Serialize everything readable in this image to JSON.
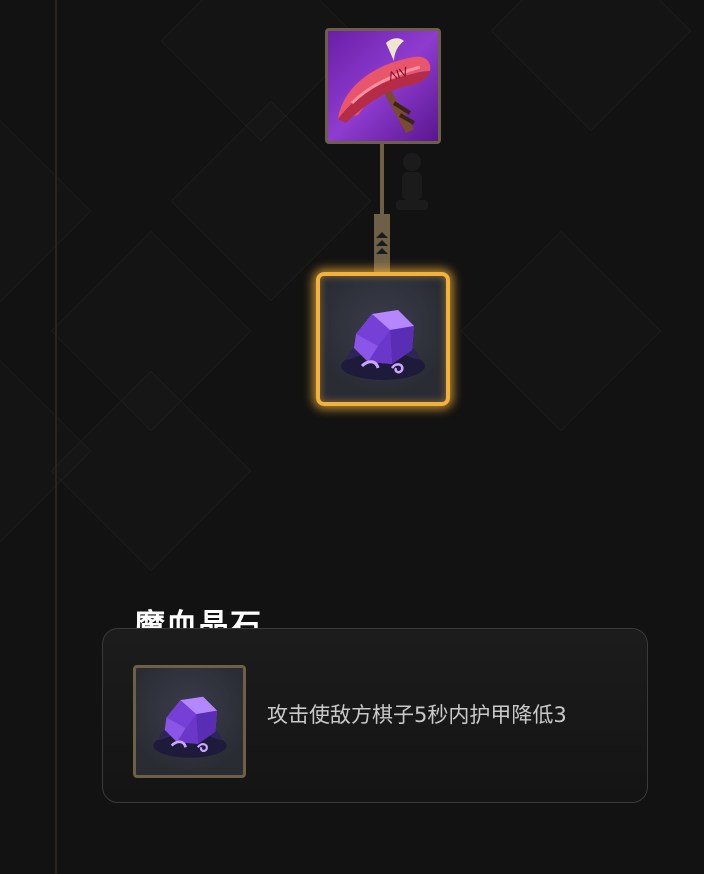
{
  "recipe": {
    "top_item_icon": "pickaxe-icon",
    "result_item_icon": "purple-crystal-icon",
    "connector_icon": "chevron-up-icon"
  },
  "detail": {
    "title": "魔血晶石",
    "icon": "purple-crystal-icon",
    "description": "攻击使敌方棋子5秒内护甲降低3"
  },
  "colors": {
    "background": "#121212",
    "slot_border": "#6e6046",
    "selected_border": "#f3b23b",
    "title": "#ffffff",
    "description": "#c9c9c9"
  }
}
